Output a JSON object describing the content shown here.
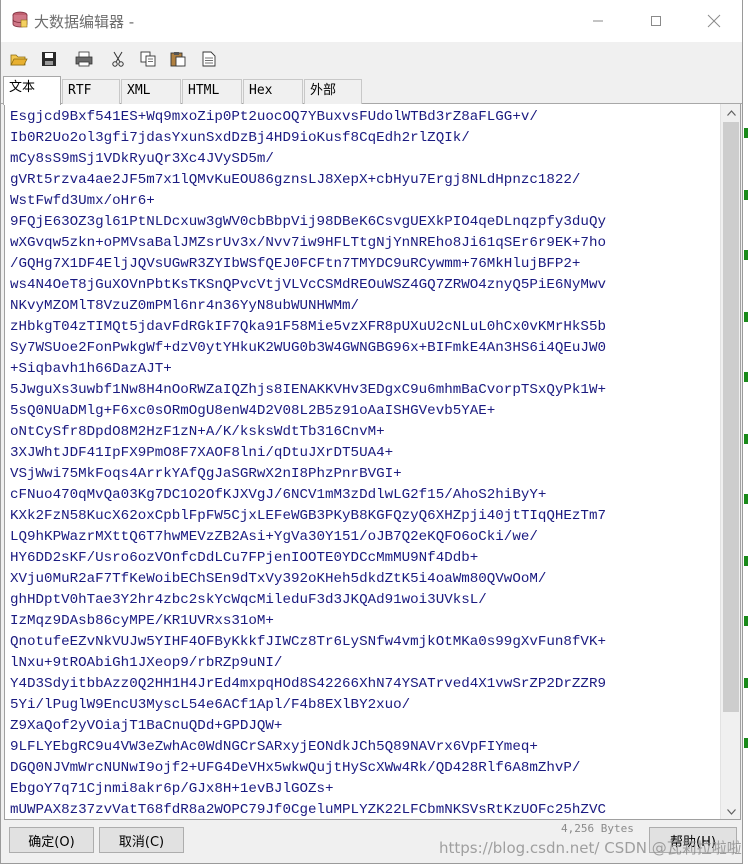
{
  "window": {
    "title": "大数据编辑器 -",
    "icon": "database-icon",
    "controls": [
      "minimize-icon",
      "maximize-icon",
      "close-icon"
    ]
  },
  "toolbar": {
    "buttons": [
      "open-folder-icon",
      "save-icon",
      "print-icon",
      "cut-icon",
      "copy-icon",
      "paste-icon",
      "document-icon"
    ]
  },
  "tabs": [
    {
      "label": "文本",
      "active": true
    },
    {
      "label": "RTF"
    },
    {
      "label": "XML"
    },
    {
      "label": "HTML"
    },
    {
      "label": "Hex"
    },
    {
      "label": "外部"
    }
  ],
  "editor": {
    "lines": [
      "Esgjcd9Bxf541ES+Wq9mxoZip0Pt2uocOQ7YBuxvsFUdolWTBd3rZ8aFLGG+v/",
      "Ib0R2Uo2ol3gfi7jdasYxunSxdDzBj4HD9ioKusf8CqEdh2rlZQIk/",
      "mCy8sS9mSj1VDkRyuQr3Xc4JVySD5m/",
      "gVRt5rzva4ae2JF5m7x1lQMvKuEOU86gznsLJ8XepX+cbHyu7Ergj8NLdHpnzc1822/",
      "WstFwfd3Umx/oHr6+",
      "9FQjE63OZ3gl61PtNLDcxuw3gWV0cbBbpVij98DBeK6CsvgUEXkPIO4qeDLnqzpfy3duQy",
      "wXGvqw5zkn+oPMVsaBalJMZsrUv3x/Nvv7iw9HFLTtgNjYnNREho8Ji61qSEr6r9EK+7ho",
      "/GQHg7X1DF4EljJQVsUGwR3ZYIbWSfQEJ0FCFtn7TMYDC9uRCywmm+76MkHlujBFP2+",
      "ws4N4OeT8jGuXOVnPbtKsTKSnQPvcVtjVLVcCSMdREOuWSZ4GQ7ZRWO4znyQ5PiE6NyMwv",
      "NKvyMZOMlT8VzuZ0mPMl6nr4n36YyN8ubWUNHWMm/",
      "zHbkgT04zTIMQt5jdavFdRGkIF7Qka91F58Mie5vzXFR8pUXuU2cNLuL0hCx0vKMrHkS5b",
      "Sy7WSUoe2FonPwkgWf+dzV0ytYHkuK2WUG0b3W4GWNGBG96x+BIFmkE4An3HS6i4QEuJW0",
      "+Siqbavh1h66DazAJT+",
      "5JwguXs3uwbf1Nw8H4nOoRWZaIQZhjs8IENAKKVHv3EDgxC9u6mhmBaCvorpTSxQyPk1W+",
      "5sQ0NUaDMlg+F6xc0sORmOgU8enW4D2V08L2B5z91oAaISHGVevb5YAE+",
      "oNtCySfr8DpdO8M2HzF1zN+A/K/ksksWdtTb316CnvM+",
      "3XJWhtJDF41IpFX9PmO8F7XAOF8lni/qDtuJXrDT5UA4+",
      "VSjWwi75MkFoqs4ArrkYAfQgJaSGRwX2nI8PhzPnrBVGI+",
      "cFNuo470qMvQa03Kg7DC1O2OfKJXVgJ/6NCV1mM3zDdlwLG2f15/AhoS2hiByY+",
      "KXk2FzN58KucX62oxCpblFpFW5CjxLEFeWGB3PKyB8KGFQzyQ6XHZpji40jtTIqQHEzTm7",
      "LQ9hKPWazrMXttQ6T7hwMEVzZB2Asi+YgVa30Y151/oJB7Q2eKQFO6oCki/we/",
      "HY6DD2sKF/Usro6ozVOnfcDdLCu7FPjenIOOTE0YDCcMmMU9Nf4Ddb+",
      "XVju0MuR2aF7TfKeWoibEChSEn9dTxVy392oKHeh5dkdZtK5i4oaWm80QVwOoM/",
      "ghHDptV0hTae3Y2hr4zbc2skYcWqcMileduF3d3JKQAd91woi3UVksL/",
      "IzMqz9DAsb86cyMPE/KR1UVRxs31oM+",
      "QnotufeEZvNkVUJw5YIHF4OFByKkkfJIWCz8Tr6LySNfw4vmjkOtMKa0s99gXvFun8fVK+",
      "lNxu+9tROAbiGh1JXeop9/rbRZp9uNI/",
      "Y4D3SdyitbbAzz0Q2HH1H4JrEd4mxpqHOd8S42266XhN74YSATrved4X1vwSrZP2DrZZR9",
      "5Yi/lPuglW9EncU3MyscL54e6ACf1Apl/F4b8EXlBY2xuo/",
      "Z9XaQof2yVOiajT1BaCnuQDd+GPDJQW+",
      "9LFLYEbgRC9u4VW3eZwhAc0WdNGCrSARxyjEONdkJCh5Q89NAVrx6VpFIYmeq+",
      "DGQ0NJVmWrcNUNwI9ojf2+UFG4DeVHx5wkwQujtHyScXWw4Rk/QD428Rlf6A8mZhvP/",
      "EbgoY7q71Cjnmi8akr6p/GJx8H+1evBJlGOZs+",
      "mUWPAX8z37zvVatT68fdR8a2WOPC79Jf0CgeluMPLYZK22LFCbmNKSVsRtKzUOFc25hZVC"
    ]
  },
  "footer": {
    "ok_label": "确定(O)",
    "cancel_label": "取消(C)",
    "help_label": "帮助(H)",
    "byte_count": "4,256 Bytes",
    "watermark": "https://blog.csdn.net/ CSDN @瓦莉拉啦啦"
  }
}
